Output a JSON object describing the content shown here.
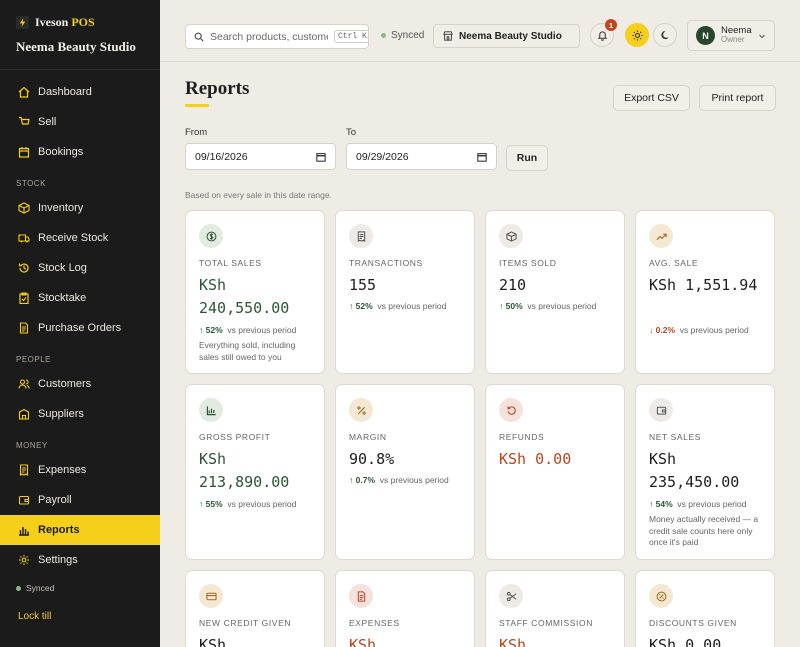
{
  "app": {
    "brand_prefix": "Iveson",
    "brand_suffix": "POS",
    "store": "Neema Beauty Studio"
  },
  "sidebar": {
    "items": [
      {
        "label": "Dashboard",
        "icon": "home-icon"
      },
      {
        "label": "Sell",
        "icon": "cart-icon"
      },
      {
        "label": "Bookings",
        "icon": "calendar-icon"
      },
      {
        "label": "STOCK",
        "type": "section"
      },
      {
        "label": "Inventory",
        "icon": "box-icon"
      },
      {
        "label": "Receive Stock",
        "icon": "truck-icon"
      },
      {
        "label": "Stock Log",
        "icon": "history-icon"
      },
      {
        "label": "Stocktake",
        "icon": "clipboard-check-icon"
      },
      {
        "label": "Purchase Orders",
        "icon": "document-icon"
      },
      {
        "label": "PEOPLE",
        "type": "section"
      },
      {
        "label": "Customers",
        "icon": "users-icon"
      },
      {
        "label": "Suppliers",
        "icon": "building-icon"
      },
      {
        "label": "MONEY",
        "type": "section"
      },
      {
        "label": "Expenses",
        "icon": "receipt-icon"
      },
      {
        "label": "Payroll",
        "icon": "wallet-icon"
      },
      {
        "label": "Reports",
        "icon": "bar-chart-icon",
        "active": true
      },
      {
        "label": "Settings",
        "icon": "gear-icon"
      }
    ],
    "sync_status": "Synced",
    "lock_label": "Lock till"
  },
  "topbar": {
    "search_placeholder": "Search products, customers",
    "search_shortcut": "Ctrl K",
    "sync_status": "Synced",
    "store_chip": "Neema Beauty Studio",
    "notification_count": "1",
    "user": {
      "initial": "N",
      "name": "Neema",
      "role": "Owner"
    }
  },
  "page": {
    "title": "Reports",
    "export_label": "Export CSV",
    "print_label": "Print report",
    "from_label": "From",
    "to_label": "To",
    "from_date": "09/16/2026",
    "to_date": "09/29/2026",
    "run_label": "Run",
    "note": "Based on every sale in this date range."
  },
  "cards": [
    {
      "label": "TOTAL SALES",
      "value": "KSh 240,550.00",
      "value_color": "green",
      "delta": "52%",
      "delta_dir": "up",
      "delta_text": "vs previous period",
      "note": "Everything sold, including sales still owed to you",
      "icon": "dollar-icon",
      "icon_bg": "green"
    },
    {
      "label": "TRANSACTIONS",
      "value": "155",
      "value_color": "default",
      "delta": "52%",
      "delta_dir": "up",
      "delta_text": "vs previous period",
      "icon": "receipt-icon",
      "icon_bg": "gray"
    },
    {
      "label": "ITEMS SOLD",
      "value": "210",
      "value_color": "default",
      "delta": "50%",
      "delta_dir": "up",
      "delta_text": "vs previous period",
      "icon": "box-icon",
      "icon_bg": "gray"
    },
    {
      "label": "AVG. SALE",
      "value": "KSh 1,551.94",
      "value_color": "default",
      "delta": "0.2%",
      "delta_dir": "down",
      "delta_text": "vs previous period",
      "icon": "trend-up-icon",
      "icon_bg": "tan"
    },
    {
      "label": "GROSS PROFIT",
      "value": "KSh 213,890.00",
      "value_color": "green",
      "delta": "55%",
      "delta_dir": "up",
      "delta_text": "vs previous period",
      "icon": "chart-icon",
      "icon_bg": "green"
    },
    {
      "label": "MARGIN",
      "value": "90.8%",
      "value_color": "default",
      "delta": "0.7%",
      "delta_dir": "up",
      "delta_text": "vs previous period",
      "icon": "percent-icon",
      "icon_bg": "tan"
    },
    {
      "label": "REFUNDS",
      "value": "KSh 0.00",
      "value_color": "red",
      "icon": "refund-icon",
      "icon_bg": "red"
    },
    {
      "label": "NET SALES",
      "value": "KSh 235,450.00",
      "value_color": "default",
      "delta": "54%",
      "delta_dir": "up",
      "delta_text": "vs previous period",
      "note": "Money actually received — a credit sale counts here only once it's paid",
      "icon": "wallet-icon",
      "icon_bg": "gray"
    },
    {
      "label": "NEW CREDIT GIVEN",
      "value": "KSh",
      "value_color": "default",
      "icon": "card-icon",
      "icon_bg": "tan"
    },
    {
      "label": "EXPENSES",
      "value": "KSh",
      "value_color": "red",
      "icon": "document-icon",
      "icon_bg": "red"
    },
    {
      "label": "STAFF COMMISSION",
      "value": "KSh",
      "value_color": "red",
      "icon": "scissors-icon",
      "icon_bg": "gray"
    },
    {
      "label": "DISCOUNTS GIVEN",
      "value": "KSh 0.00",
      "value_color": "default",
      "icon": "discount-icon",
      "icon_bg": "tan"
    }
  ]
}
